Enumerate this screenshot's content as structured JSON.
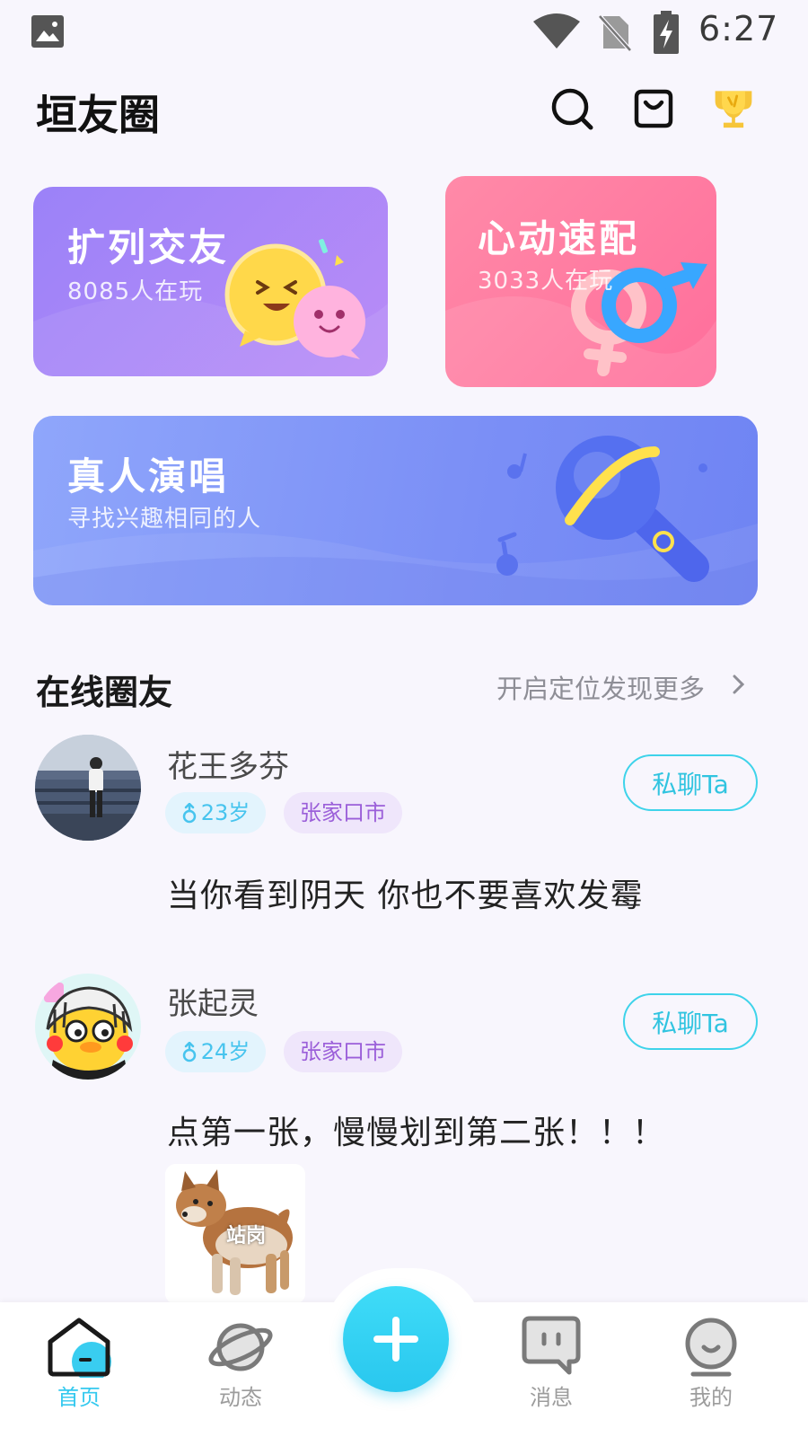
{
  "status_bar": {
    "time": "6:27"
  },
  "header": {
    "title": "垣友圈"
  },
  "cards": {
    "make_friends": {
      "title": "扩列交友",
      "subtitle": "8085人在玩"
    },
    "heart_match": {
      "title": "心动速配",
      "subtitle": "3033人在玩"
    },
    "live_singing": {
      "title": "真人演唱",
      "subtitle": "寻找兴趣相同的人"
    }
  },
  "online": {
    "title": "在线圈友",
    "more_link": "开启定位发现更多",
    "users": [
      {
        "name": "花王多芬",
        "age": "23岁",
        "city": "张家口市",
        "chat_label": "私聊Ta",
        "post": "当你看到阴天 你也不要喜欢发霉"
      },
      {
        "name": "张起灵",
        "age": "24岁",
        "city": "张家口市",
        "chat_label": "私聊Ta",
        "post": "点第一张，慢慢划到第二张！！！",
        "photo_caption": "站岗"
      }
    ]
  },
  "bottom_nav": {
    "items": [
      {
        "label": "首页",
        "icon": "home-icon",
        "active": true
      },
      {
        "label": "动态",
        "icon": "planet-icon"
      },
      {
        "label": "消息",
        "icon": "message-icon"
      },
      {
        "label": "我的",
        "icon": "profile-icon"
      }
    ],
    "post_button_icon": "plus-icon"
  },
  "colors": {
    "accent": "#35c9ef",
    "chat_border": "#3ed3ea",
    "age_tag": "#47c4ee",
    "city_tag": "#9b5fd9"
  }
}
